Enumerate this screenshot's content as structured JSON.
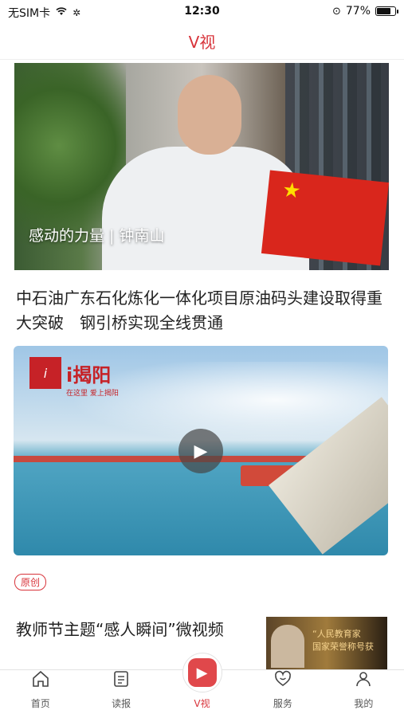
{
  "status_bar": {
    "carrier": "无SIM卡",
    "time": "12:30",
    "battery": "77%"
  },
  "header": {
    "title": "V视"
  },
  "feed": {
    "hero": {
      "caption": "感动的力量 | 钟南山"
    },
    "article1": {
      "title": "中石油广东石化炼化一体化项目原油码头建设取得重大突破　钢引桥实现全线贯通"
    },
    "video": {
      "logo_badge": "i",
      "logo_name": "i揭阳",
      "logo_slogan": "在这里 爱上揭阳"
    },
    "tag": "原创",
    "article2": {
      "title": "教师节主题“感人瞬间”微视频",
      "thumb_text_1": "“人民教育家",
      "thumb_text_2": "国家荣誉称号获"
    }
  },
  "tabbar": {
    "items": [
      {
        "label": "首页",
        "icon": "home-icon"
      },
      {
        "label": "读报",
        "icon": "newspaper-icon"
      },
      {
        "label": "V视",
        "icon": "video-icon"
      },
      {
        "label": "服务",
        "icon": "smile-heart-icon"
      },
      {
        "label": "我的",
        "icon": "person-icon"
      }
    ]
  },
  "colors": {
    "accent": "#d8343b"
  }
}
